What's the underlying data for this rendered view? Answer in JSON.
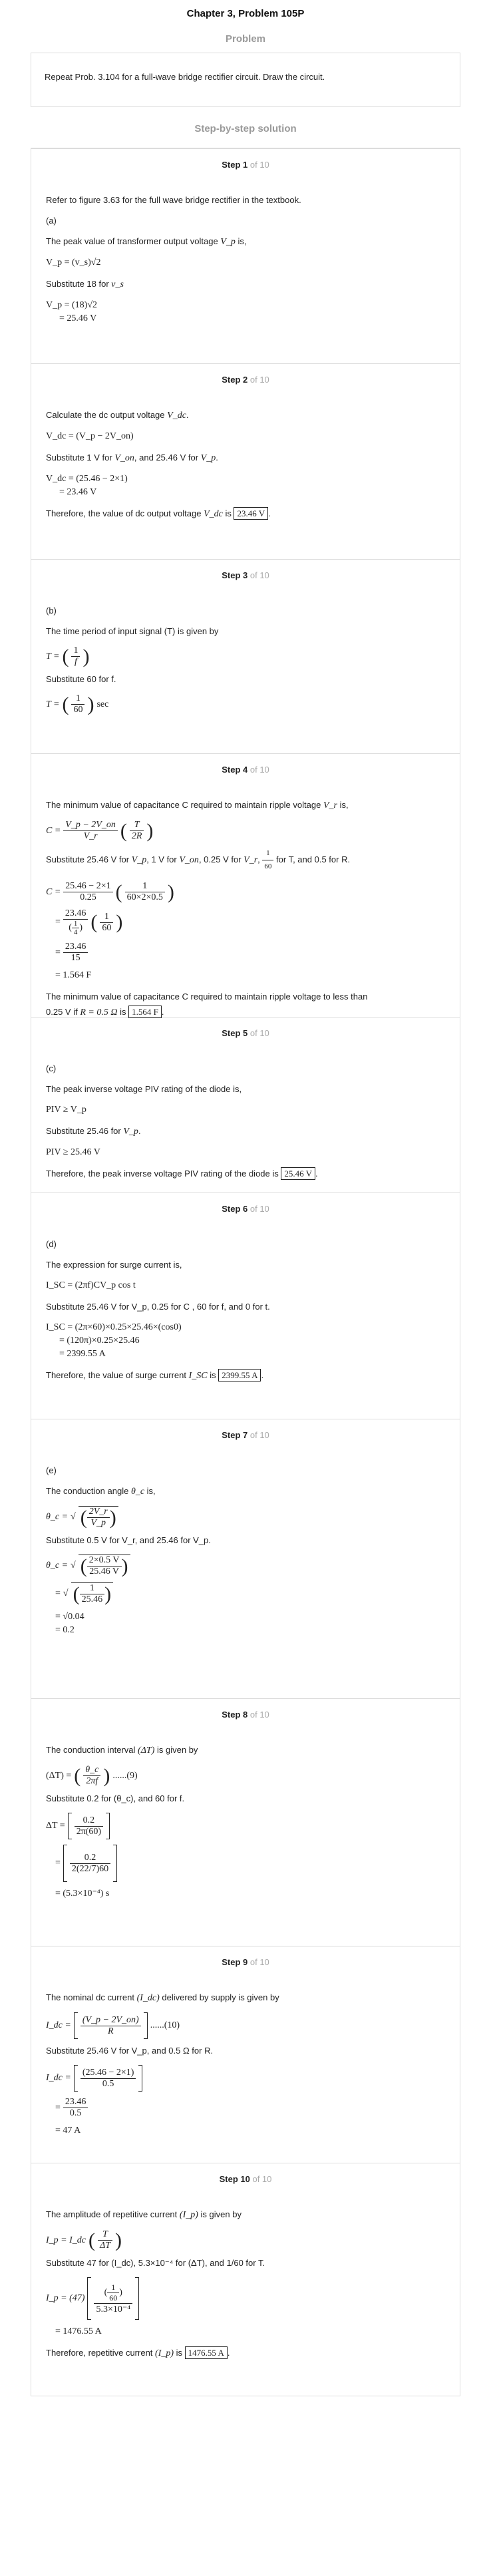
{
  "page_title": "Chapter 3, Problem 105P",
  "problem_heading": "Problem",
  "problem_text": "Repeat Prob. 3.104 for a full-wave bridge rectifier circuit. Draw the circuit.",
  "solution_heading": "Step-by-step solution",
  "step_of": "of 10",
  "steps": [
    {
      "label": "Step 1",
      "lines": [
        "Refer to figure 3.63 for the full wave bridge rectifier in the textbook.",
        "(a)",
        "The peak value of transformer output voltage",
        "Substitute 18 for"
      ],
      "var_vp": "V_p",
      "is": "is,",
      "eq1": "V_p = (v_s)√2",
      "vs": "v_s",
      "eq2a": "V_p = (18)√2",
      "eq2b": "= 25.46 V"
    },
    {
      "label": "Step 2",
      "line1": "Calculate the dc output voltage",
      "var_vdc": "V_dc",
      "eq1": "V_dc = (V_p − 2V_on)",
      "line2a": "Substitute 1 V for",
      "von": "V_on",
      "line2b": ", and 25.46 V for",
      "vp": "V_p",
      "eq2a": "V_dc = (25.46 − 2×1)",
      "eq2b": "= 23.46 V",
      "line3a": "Therefore, the value of dc output voltage",
      "line3b": "is",
      "answer": "23.46 V"
    },
    {
      "label": "Step 3",
      "line1": "(b)",
      "line2": "The time period of input signal (T) is given by",
      "eq1_lhs": "T =",
      "eq1_num": "1",
      "eq1_den": "f",
      "line3": "Substitute 60 for f.",
      "eq2_lhs": "T =",
      "eq2_num": "1",
      "eq2_den": "60",
      "eq2_unit": "sec"
    },
    {
      "label": "Step 4",
      "line1a": "The minimum value of capacitance C required to maintain ripple voltage",
      "vr": "V_r",
      "line1b": "is,",
      "eq1_lhs": "C =",
      "eq1_num": "V_p − 2V_on",
      "eq1_den": "V_r",
      "eq1_num2": "T",
      "eq1_den2": "2R",
      "line2a": "Substitute 25.46 V for",
      "line2_vp": "V_p",
      "line2b": ", 1 V for",
      "line2_von": "V_on",
      "line2c": ", 0.25 V for",
      "line2_vr": "V_r",
      "line2d": ",",
      "line2_num": "1",
      "line2_den": "60",
      "line2e": "for T, and 0.5 for R.",
      "eq2a_lhs": "C =",
      "eq2a_num": "25.46 − 2×1",
      "eq2a_den": "0.25",
      "eq2a_num2": "1",
      "eq2a_den2": "60×2×0.5",
      "eq2b_num": "23.46",
      "eq2b_den_num": "1",
      "eq2b_den_den": "4",
      "eq2b_num2": "1",
      "eq2b_den2": "60",
      "eq2c_num": "23.46",
      "eq2c_den": "15",
      "eq2d": "= 1.564 F",
      "line3a": "The minimum value of capacitance C required to maintain ripple voltage to less than",
      "line3b": "0.25 V if",
      "line3_r": "R = 0.5 Ω",
      "line3c": "is",
      "answer": "1.564 F"
    },
    {
      "label": "Step 5",
      "line1": "(c)",
      "line2": "The peak inverse voltage PIV rating of the diode is,",
      "eq1": "PIV ≥ V_p",
      "line3a": "Substitute 25.46 for",
      "vp": "V_p",
      "eq2": "PIV ≥ 25.46 V",
      "line4a": "Therefore, the peak inverse voltage PIV rating of the diode is",
      "answer": "25.46 V"
    },
    {
      "label": "Step 6",
      "line1": "(d)",
      "line2": "The expression for surge current is,",
      "eq1": "I_SC = (2πf)CV_p cos t",
      "line3": "Substitute 25.46 V for V_p, 0.25 for C , 60 for f, and 0 for t.",
      "eq2a": "I_SC = (2π×60)×0.25×25.46×(cos0)",
      "eq2b": "= (120π)×0.25×25.46",
      "eq2c": "= 2399.55 A",
      "line4a": "Therefore, the value of surge current",
      "isc": "I_SC",
      "line4b": "is",
      "answer": "2399.55 A"
    },
    {
      "label": "Step 7",
      "line1": "(e)",
      "line2a": "The conduction angle",
      "theta": "θ_c",
      "line2b": "is,",
      "eq1_lhs": "θ_c =",
      "eq1_num": "2V_r",
      "eq1_den": "V_p",
      "line3": "Substitute 0.5 V for V_r, and 25.46 for V_p.",
      "eq2_lhs": "θ_c =",
      "eq2_num": "2×0.5 V",
      "eq2_den": "25.46 V",
      "eq3_num": "1",
      "eq3_den": "25.46",
      "eq4": "= √0.04",
      "eq5": "= 0.2"
    },
    {
      "label": "Step 8",
      "line1a": "The conduction interval",
      "dt": "(ΔT)",
      "line1b": "is given by",
      "eq1_lhs": "(ΔT) =",
      "eq1_num": "θ_c",
      "eq1_den": "2πf",
      "eq1_tag": "......(9)",
      "line2": "Substitute 0.2 for (θ_c), and 60 for f.",
      "eq2_lhs": "ΔT =",
      "eq2_num": "0.2",
      "eq2_den": "2π(60)",
      "eq3_num": "0.2",
      "eq3_den": "2(22/7)60",
      "eq4": "= (5.3×10⁻⁴) s"
    },
    {
      "label": "Step 9",
      "line1a": "The nominal dc current",
      "idc": "(I_dc)",
      "line1b": "delivered by supply is given by",
      "eq1_lhs": "I_dc =",
      "eq1_num": "(V_p − 2V_on)",
      "eq1_den": "R",
      "eq1_tag": "......(10)",
      "line2": "Substitute 25.46 V for V_p, and 0.5 Ω for R.",
      "eq2_lhs": "I_dc =",
      "eq2_num": "(25.46 − 2×1)",
      "eq2_den": "0.5",
      "eq3_num": "23.46",
      "eq3_den": "0.5",
      "eq4": "= 47 A"
    },
    {
      "label": "Step 10",
      "line1a": "The amplitude of repetitive current",
      "ip": "(I_p)",
      "line1b": "is given by",
      "eq1_lhs": "I_p = I_dc",
      "eq1_num": "T",
      "eq1_den": "ΔT",
      "line2": "Substitute 47 for (I_dc), 5.3×10⁻⁴ for (ΔT), and 1/60 for T.",
      "eq2_lhs": "I_p = (47)",
      "eq2_num_num": "1",
      "eq2_num_den": "60",
      "eq2_den": "5.3×10⁻⁴",
      "eq3": "= 1476.55 A",
      "line3a": "Therefore, repetitive current",
      "line3b": "is",
      "answer": "1476.55 A"
    }
  ]
}
